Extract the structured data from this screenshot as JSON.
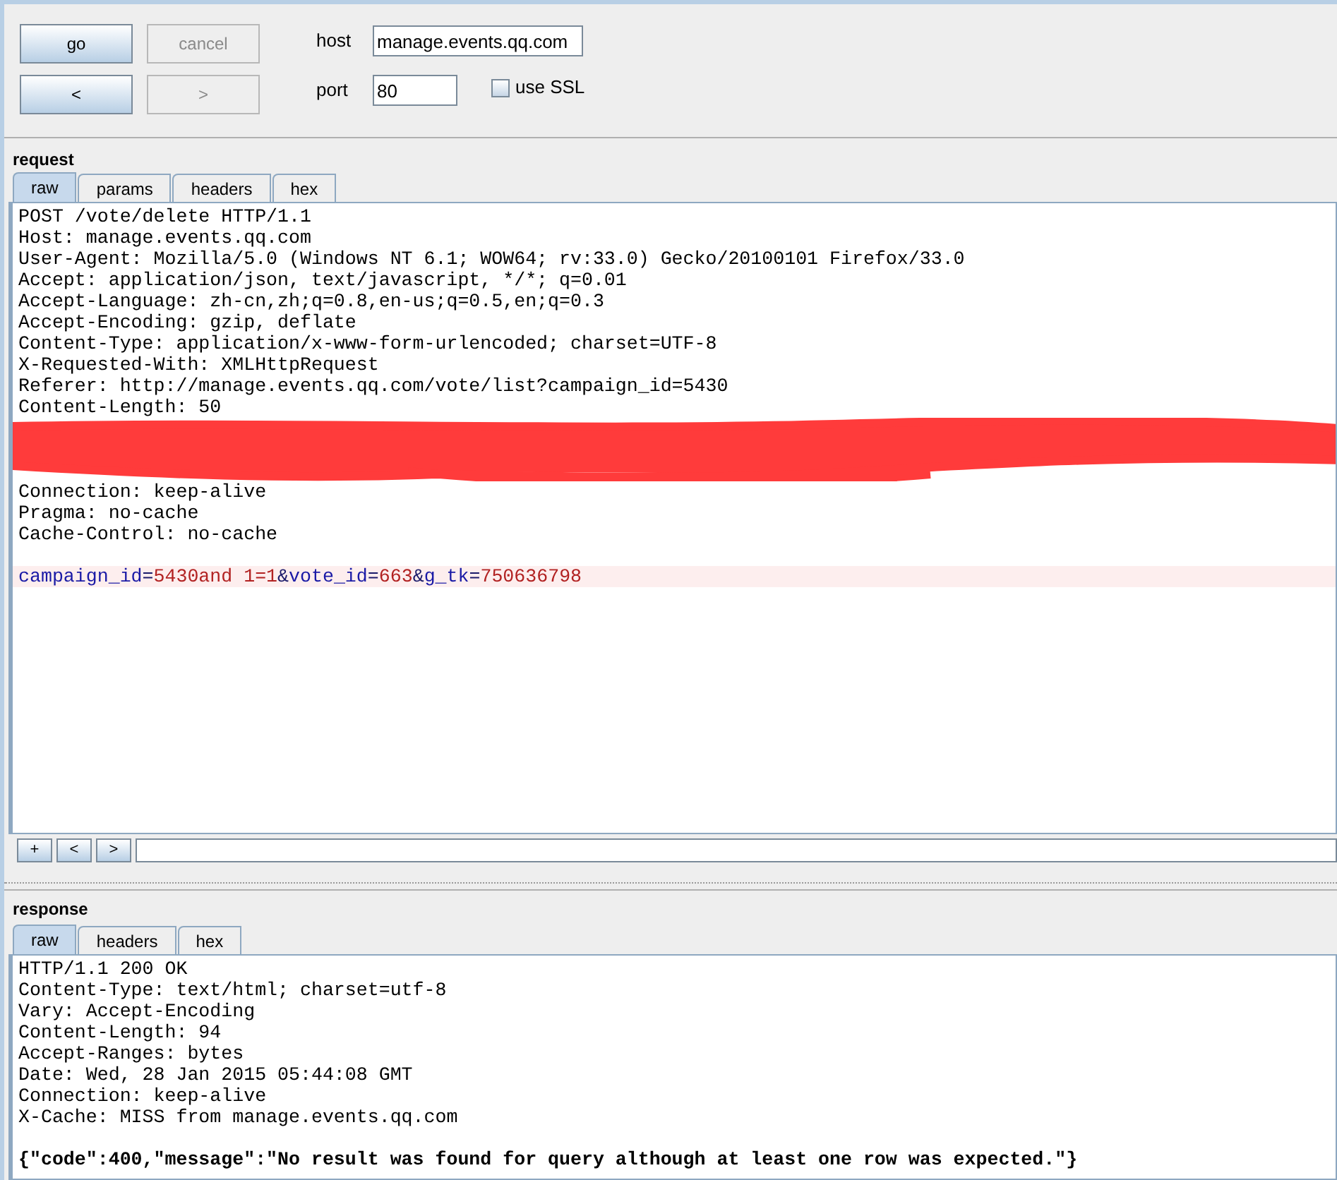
{
  "controls": {
    "buttons": [
      {
        "label": "go",
        "disabled": false
      },
      {
        "label": "cancel",
        "disabled": true
      },
      {
        "label": "<",
        "disabled": false
      },
      {
        "label": ">",
        "disabled": true
      }
    ],
    "host": {
      "label": "host",
      "value": "manage.events.qq.com"
    },
    "port": {
      "label": "port",
      "value": "80"
    },
    "use_ssl": {
      "label": "use SSL",
      "checked": false
    }
  },
  "request": {
    "title": "request",
    "tabs": [
      {
        "label": "raw",
        "selected": true
      },
      {
        "label": "params",
        "selected": false
      },
      {
        "label": "headers",
        "selected": false
      },
      {
        "label": "hex",
        "selected": false
      }
    ],
    "lines": [
      {
        "kind": "text",
        "text": "POST /vote/delete HTTP/1.1"
      },
      {
        "kind": "text",
        "text": "Host: manage.events.qq.com"
      },
      {
        "kind": "text",
        "text": "User-Agent: Mozilla/5.0 (Windows NT 6.1; WOW64; rv:33.0) Gecko/20100101 Firefox/33.0"
      },
      {
        "kind": "text",
        "text": "Accept: application/json, text/javascript, */*; q=0.01"
      },
      {
        "kind": "text",
        "text": "Accept-Language: zh-cn,zh;q=0.8,en-us;q=0.5,en;q=0.3"
      },
      {
        "kind": "text",
        "text": "Accept-Encoding: gzip, deflate"
      },
      {
        "kind": "text",
        "text": "Content-Type: application/x-www-form-urlencoded; charset=UTF-8"
      },
      {
        "kind": "text",
        "text": "X-Requested-With: XMLHttpRequest"
      },
      {
        "kind": "text",
        "text": "Referer: http://manage.events.qq.com/vote/list?campaign_id=5430"
      },
      {
        "kind": "text",
        "text": "Content-Length: 50"
      },
      {
        "kind": "redacted"
      },
      {
        "kind": "text",
        "text": "Connection: keep-alive"
      },
      {
        "kind": "text",
        "text": "Pragma: no-cache"
      },
      {
        "kind": "text",
        "text": "Cache-Control: no-cache"
      },
      {
        "kind": "blank"
      },
      {
        "kind": "params",
        "segments": [
          {
            "kind": "name",
            "text": "campaign_id"
          },
          {
            "kind": "punct",
            "text": "="
          },
          {
            "kind": "value",
            "text": "5430and 1=1"
          },
          {
            "kind": "punct",
            "text": "&"
          },
          {
            "kind": "name",
            "text": "vote_id"
          },
          {
            "kind": "punct",
            "text": "="
          },
          {
            "kind": "value",
            "text": "663"
          },
          {
            "kind": "punct",
            "text": "&"
          },
          {
            "kind": "name",
            "text": "g_tk"
          },
          {
            "kind": "punct",
            "text": "="
          },
          {
            "kind": "value",
            "text": "750636798"
          }
        ]
      }
    ],
    "nav_buttons": [
      "+",
      "<",
      ">"
    ]
  },
  "response": {
    "title": "response",
    "tabs": [
      {
        "label": "raw",
        "selected": true
      },
      {
        "label": "headers",
        "selected": false
      },
      {
        "label": "hex",
        "selected": false
      }
    ],
    "lines": [
      {
        "kind": "text",
        "text": "HTTP/1.1 200 OK"
      },
      {
        "kind": "text",
        "text": "Content-Type: text/html; charset=utf-8"
      },
      {
        "kind": "text",
        "text": "Vary: Accept-Encoding"
      },
      {
        "kind": "text",
        "text": "Content-Length: 94"
      },
      {
        "kind": "text",
        "text": "Accept-Ranges: bytes"
      },
      {
        "kind": "text",
        "text": "Date: Wed, 28 Jan 2015 05:44:08 GMT"
      },
      {
        "kind": "text",
        "text": "Connection: keep-alive"
      },
      {
        "kind": "text",
        "text": "X-Cache: MISS from manage.events.qq.com"
      },
      {
        "kind": "blank"
      },
      {
        "kind": "bold",
        "text": "{\"code\":400,\"message\":\"No result was found for query although at least one row was expected.\"}"
      }
    ]
  }
}
